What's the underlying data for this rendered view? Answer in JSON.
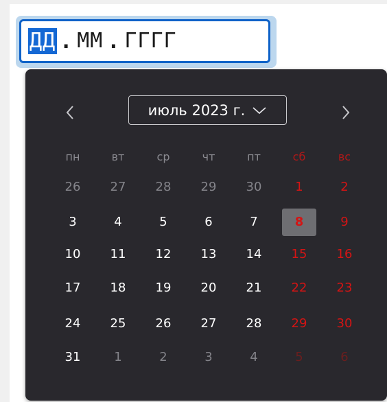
{
  "date_input": {
    "segments": [
      "ДД",
      "ММ",
      "ГГГГ"
    ],
    "separator": ".",
    "selected_segment": 0
  },
  "calendar": {
    "month_label": "июль 2023 г.",
    "weekdays": [
      "пн",
      "вт",
      "ср",
      "чт",
      "пт",
      "сб",
      "вс"
    ],
    "weeks": [
      [
        "26",
        "27",
        "28",
        "29",
        "30",
        "1",
        "2"
      ],
      [
        "3",
        "4",
        "5",
        "6",
        "7",
        "8",
        "9"
      ],
      [
        "10",
        "11",
        "12",
        "13",
        "14",
        "15",
        "16"
      ],
      [
        "17",
        "18",
        "19",
        "20",
        "21",
        "22",
        "23"
      ],
      [
        "24",
        "25",
        "26",
        "27",
        "28",
        "29",
        "30"
      ],
      [
        "31",
        "1",
        "2",
        "3",
        "4",
        "5",
        "6"
      ]
    ],
    "other_month_cells": [
      [
        0,
        0
      ],
      [
        0,
        1
      ],
      [
        0,
        2
      ],
      [
        0,
        3
      ],
      [
        0,
        4
      ],
      [
        5,
        1
      ],
      [
        5,
        2
      ],
      [
        5,
        3
      ],
      [
        5,
        4
      ],
      [
        5,
        5
      ],
      [
        5,
        6
      ]
    ],
    "today_cell": [
      1,
      5
    ],
    "icons": {
      "prev": "chevron-left-icon",
      "next": "chevron-right-icon",
      "dropdown": "chevron-down-icon"
    }
  },
  "colors": {
    "accent": "#1468d4",
    "calendar_bg": "#29282d",
    "weekend": "#d41414",
    "today_bg": "#6e6e72"
  }
}
